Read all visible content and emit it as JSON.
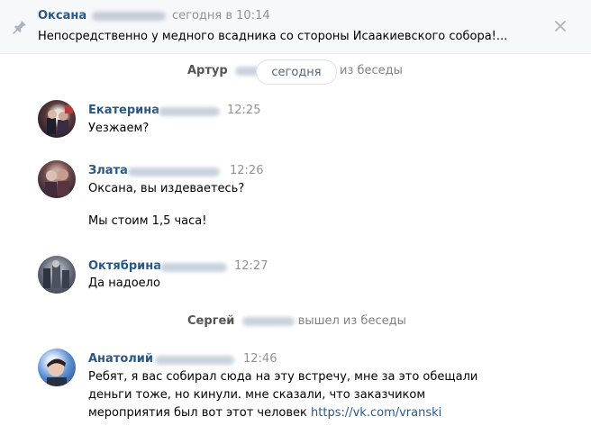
{
  "pinned": {
    "author": "Оксана",
    "time": "сегодня в 10:14",
    "text": "Непосредственно у медного всадника со стороны Исаакиевского собора!..."
  },
  "service1": {
    "name": "Артур",
    "date": "сегодня",
    "action": "из беседы"
  },
  "messages": [
    {
      "author": "Екатерина",
      "time": "12:25",
      "lines": [
        "Уезжаем?"
      ]
    },
    {
      "author": "Злата",
      "time": "12:26",
      "lines": [
        "Оксана, вы издеваетесь?",
        "Мы стоим 1,5 часа!"
      ]
    },
    {
      "author": "Октябрина",
      "time": "12:27",
      "lines": [
        "Да надоело"
      ]
    },
    {
      "author": "Анатолий",
      "time": "12:46",
      "lines": [
        "Ребят, я вас собирал сюда на эту встречу, мне за это обещали",
        "деньги тоже, но кинули. мне сказали, что заказчиком",
        "мероприятия был вот этот человек"
      ],
      "link": "https://vk.com/vranski"
    }
  ],
  "service2": {
    "name": "Сергей",
    "action": "вышел из беседы"
  }
}
